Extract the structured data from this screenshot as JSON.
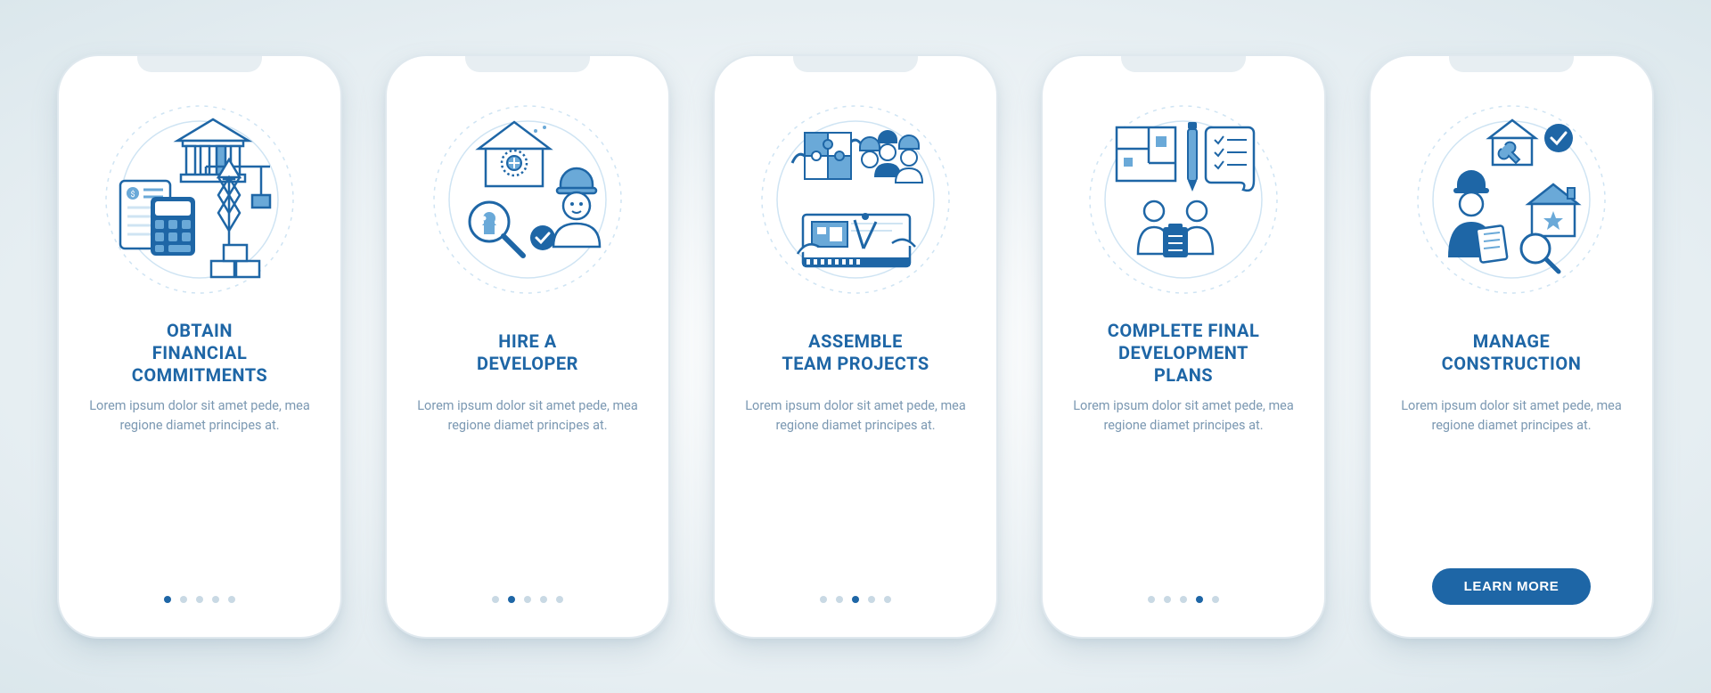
{
  "colors": {
    "primary": "#1e66a6",
    "light": "#6aa9d8",
    "pale": "#cfe4f3",
    "muted": "#7b98b2",
    "dot_inactive": "#c9d9e4"
  },
  "cta_label": "LEARN MORE",
  "slides": [
    {
      "title": "OBTAIN\nFINANCIAL\nCOMMITMENTS",
      "desc": "Lorem ipsum dolor sit amet pede, mea regione diamet principes at.",
      "icon_name": "financial-commitments-icon",
      "pagination_total": 5,
      "pagination_active": 0,
      "show_cta": false
    },
    {
      "title": "HIRE A\nDEVELOPER",
      "desc": "Lorem ipsum dolor sit amet pede, mea regione diamet principes at.",
      "icon_name": "hire-developer-icon",
      "pagination_total": 5,
      "pagination_active": 1,
      "show_cta": false
    },
    {
      "title": "ASSEMBLE\nTEAM PROJECTS",
      "desc": "Lorem ipsum dolor sit amet pede, mea regione diamet principes at.",
      "icon_name": "assemble-team-icon",
      "pagination_total": 5,
      "pagination_active": 2,
      "show_cta": false
    },
    {
      "title": "COMPLETE FINAL\nDEVELOPMENT\nPLANS",
      "desc": "Lorem ipsum dolor sit amet pede, mea regione diamet principes at.",
      "icon_name": "development-plans-icon",
      "pagination_total": 5,
      "pagination_active": 3,
      "show_cta": false
    },
    {
      "title": "MANAGE\nCONSTRUCTION",
      "desc": "Lorem ipsum dolor sit amet pede, mea regione diamet principes at.",
      "icon_name": "manage-construction-icon",
      "pagination_total": 5,
      "pagination_active": 4,
      "show_cta": true
    }
  ]
}
